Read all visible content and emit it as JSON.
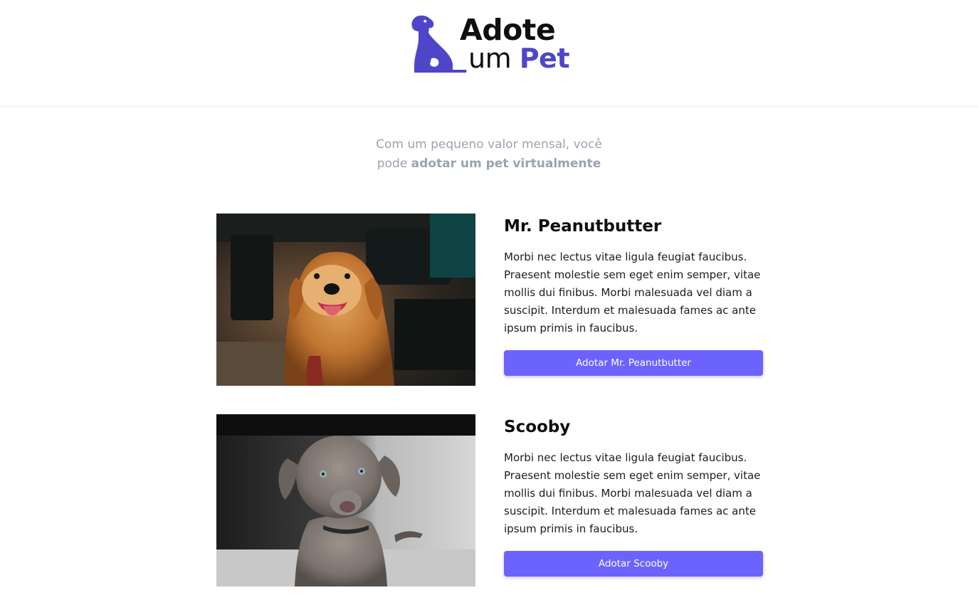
{
  "header": {
    "logo": {
      "line1": "Adote",
      "line2_prefix": "um",
      "line2_accent": "Pet"
    }
  },
  "intro": {
    "line1": "Com um pequeno valor mensal, você",
    "line2_prefix": "pode",
    "line2_bold": "adotar um pet virtualmente"
  },
  "pets": [
    {
      "name": "Mr. Peanutbutter",
      "description": "Morbi nec lectus vitae ligula feugiat faucibus. Praesent molestie sem eget enim semper, vitae mollis dui finibus. Morbi malesuada vel diam a suscipit. Interdum et malesuada fames ac ante ipsum primis in faucibus.",
      "button_label": "Adotar Mr. Peanutbutter",
      "photo_icon": "golden-retriever-photo"
    },
    {
      "name": "Scooby",
      "description": "Morbi nec lectus vitae ligula feugiat faucibus. Praesent molestie sem eget enim semper, vitae mollis dui finibus. Morbi malesuada vel diam a suscipit. Interdum et malesuada fames ac ante ipsum primis in faucibus.",
      "button_label": "Adotar Scooby",
      "photo_icon": "weimaraner-puppy-photo"
    }
  ],
  "colors": {
    "brand": "#4e46c9",
    "button": "#6c63ff",
    "muted_text": "#9aa2b1",
    "heading": "#0f0f10"
  }
}
